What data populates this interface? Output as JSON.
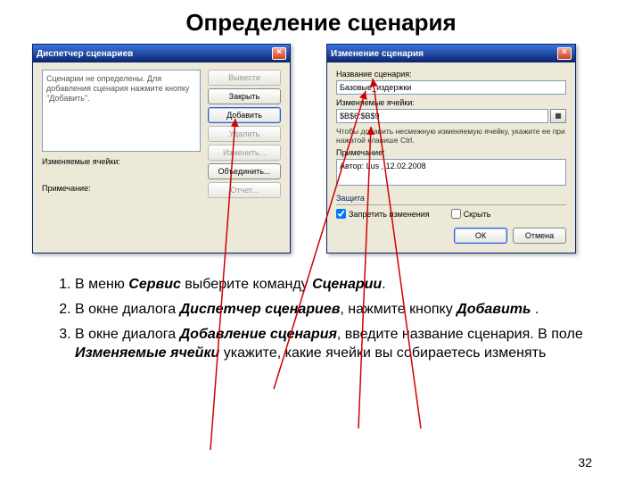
{
  "title": "Определение сценария",
  "page_number": "32",
  "dialog1": {
    "title": "Диспетчер сценариев",
    "list_text": "Сценарии не определены. Для добавления сценария нажмите кнопку \"Добавить\".",
    "changing_cells_label": "Изменяемые ячейки:",
    "note_label": "Примечание:",
    "buttons": {
      "show": "Вывести",
      "close": "Закрыть",
      "add": "Добавить",
      "delete": "Удалить",
      "edit": "Изменить...",
      "merge": "Объединить...",
      "report": "Отчет..."
    }
  },
  "dialog2": {
    "title": "Изменение сценария",
    "name_label": "Название сценария:",
    "name_value": "Базовые_издержки",
    "cells_label": "Изменяемые ячейки:",
    "cells_value": "$B$6:$B$9",
    "help_text": "Чтобы добавить несмежную изменяемую ячейку, укажите ее при нажатой клавише Ctrl.",
    "note_label": "Примечание:",
    "note_value": "Автор: Lus , 12.02.2008",
    "protection_header": "Защита",
    "chk_prevent": "Запретить изменения",
    "chk_hide": "Скрыть",
    "ok": "ОК",
    "cancel": "Отмена"
  },
  "instructions": {
    "item1_a": "В меню ",
    "item1_b": "Сервис",
    "item1_c": "  выберите команду ",
    "item1_d": "Сценарии",
    "item1_e": ".",
    "item2_a": " В окне диалога ",
    "item2_b": "Диспетчер сценариев",
    "item2_c": ", нажмите кнопку ",
    "item2_d": "Добавить",
    "item2_e": " .",
    "item3_a": " В окне диалога ",
    "item3_b": "Добавление сценария",
    "item3_c": ", введите название сценария. В поле ",
    "item3_d": "Изменяемые ячейки",
    "item3_e": "  укажите, какие ячейки вы собираетесь изменять"
  }
}
